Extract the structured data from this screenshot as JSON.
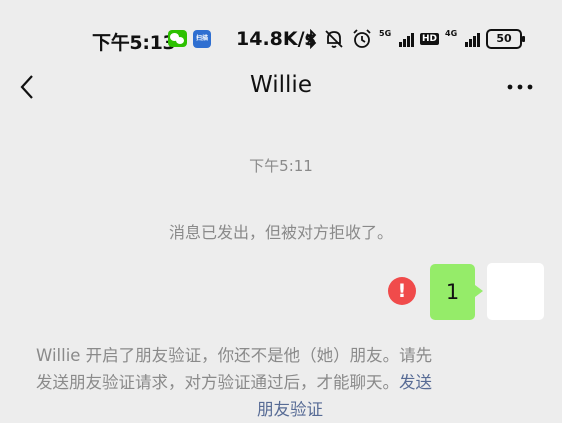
{
  "status_bar": {
    "time": "下午5:13",
    "app_icon_text": "扫描",
    "net_speed": "14.8K/s",
    "signal1_tag": "5G",
    "signal2_tag": "4G",
    "hd_label": "HD",
    "battery": "50"
  },
  "nav": {
    "title": "Willie"
  },
  "chat": {
    "timestamp": "下午5:11",
    "rejected_notice": "消息已发出，但被对方拒收了。",
    "sent_message": "1",
    "error_mark": "!",
    "verify_line1": "Willie 开启了朋友验证，你还不是他（她）朋友。请先",
    "verify_line2_text": "发送朋友验证请求，对方验证通过后，才能聊天。",
    "verify_line2_link": "发送",
    "verify_line3_link": "朋友验证"
  },
  "colors": {
    "background": "#ededed",
    "sent_bubble": "#95ec69",
    "error": "#f04b4b",
    "link": "#576b95"
  }
}
